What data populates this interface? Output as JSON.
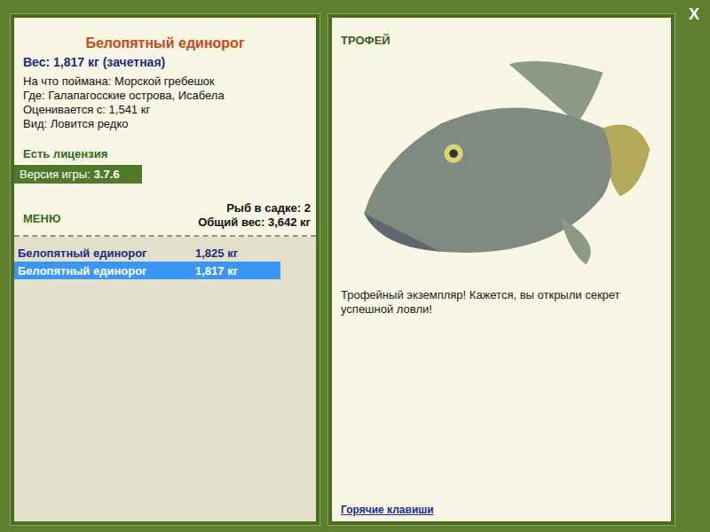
{
  "title": "Белопятный единорог",
  "weight": "Вес: 1,817 кг (зачетная)",
  "details": [
    "На что поймана: Морской гребешок",
    "Где: Галапагосские острова, Исабела",
    "Оценивается с: 1,541 кг",
    "Вид: Ловится редко"
  ],
  "license": "Есть лицензия",
  "version": {
    "label": "Версия игры:",
    "value": "3.7.6"
  },
  "menu": "МЕНЮ",
  "keepnet": {
    "count": "Рыб в садке: 2",
    "total": "Общий вес: 3,642 кг"
  },
  "catches": [
    {
      "name": "Белопятный единорог",
      "weight": "1,825 кг",
      "selected": false
    },
    {
      "name": "Белопятный единорог",
      "weight": "1,817 кг",
      "selected": true
    }
  ],
  "trophy": {
    "label": "ТРОФЕЙ",
    "message": "Трофейный экземпляр! Кажется, вы открыли секрет успешной ловли!"
  },
  "hotkeys": "Горячие клавиши",
  "close": "X"
}
